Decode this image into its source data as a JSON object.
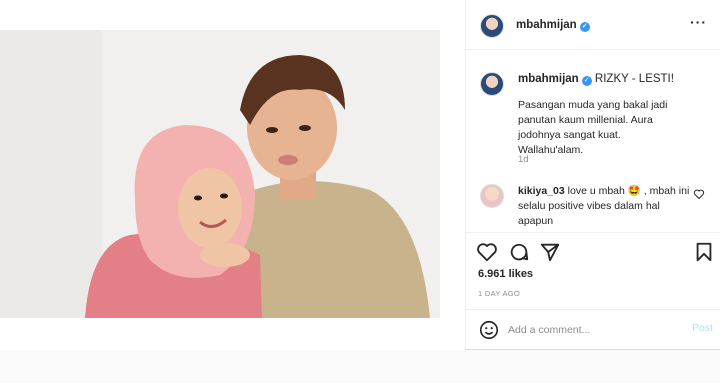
{
  "post": {
    "username": "mbahmijan",
    "caption_title": "RIZKY - LESTI!",
    "caption_body": "Pasangan muda yang bakal jadi panutan kaum millenial. Aura jodohnya sangat kuat. Wallahu'alam.",
    "caption_age": "1d",
    "likes": "6.961 likes",
    "posted_ago": "1 DAY AGO"
  },
  "comment": {
    "username": "kikiya_03",
    "text": "love u mbah 🤩 , mbah ini selalu positive vibes dalam hal apapun"
  },
  "add_comment": {
    "placeholder": "Add a comment...",
    "post_label": "Post"
  },
  "icons": {
    "more": "more-options-icon",
    "like": "heart-icon",
    "comment": "comment-icon",
    "share": "share-icon",
    "save": "bookmark-icon",
    "emoji": "emoji-icon",
    "verified": "verified-badge-icon"
  },
  "colors": {
    "verified": "#3897f0",
    "muted": "#8e8e8e",
    "post_disabled": "#b2dffc"
  }
}
